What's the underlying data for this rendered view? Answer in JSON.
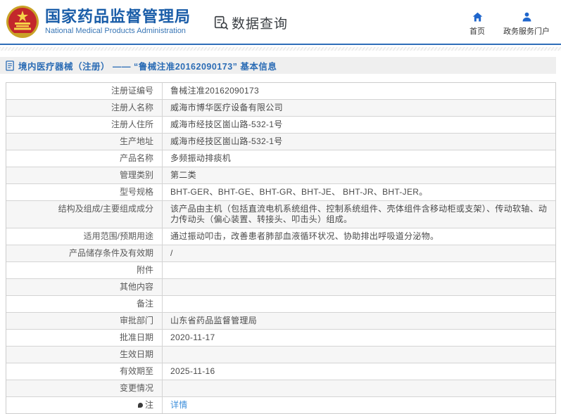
{
  "header": {
    "brand": {
      "title": "国家药品监督管理局",
      "subtitle": "National Medical Products Administration",
      "emblem_icon": "china-national-emblem",
      "title_color": "#1a5da8"
    },
    "section": {
      "icon": "data-query-icon",
      "title": "数据查询"
    },
    "nav": [
      {
        "icon": "home-icon",
        "label": "首页"
      },
      {
        "icon": "person-icon",
        "label": "政务服务门户"
      }
    ],
    "nav_icon_color": "#1f66cc"
  },
  "breadcrumb": {
    "icon": "document-icon",
    "text": "境内医疗器械（注册）  ——  “鲁械注准20162090173”  基本信息",
    "text_color": "#2b6cb5"
  },
  "table": {
    "rows": [
      {
        "label": "注册证编号",
        "value": "鲁械注准20162090173"
      },
      {
        "label": "注册人名称",
        "value": "威海市博华医疗设备有限公司"
      },
      {
        "label": "注册人住所",
        "value": "威海市经技区崮山路-532-1号"
      },
      {
        "label": "生产地址",
        "value": "威海市经技区崮山路-532-1号"
      },
      {
        "label": "产品名称",
        "value": "多频振动排痰机"
      },
      {
        "label": "管理类别",
        "value": "第二类"
      },
      {
        "label": "型号规格",
        "value": "BHT-GER、BHT-GE、BHT-GR、BHT-JE、 BHT-JR、BHT-JER。"
      },
      {
        "label": "结构及组成/主要组成成分",
        "value": "该产品由主机（包括直流电机系统组件、控制系统组件、壳体组件含移动柜或支架）、传动软轴、动力传动头（偏心装置、转接头、叩击头）组成。"
      },
      {
        "label": "适用范围/预期用途",
        "value": "通过振动叩击，改善患者肺部血液循环状况、协助排出呼吸道分泌物。"
      },
      {
        "label": "产品储存条件及有效期",
        "value": "/"
      },
      {
        "label": "附件",
        "value": ""
      },
      {
        "label": "其他内容",
        "value": ""
      },
      {
        "label": "备注",
        "value": ""
      },
      {
        "label": "审批部门",
        "value": "山东省药品监督管理局"
      },
      {
        "label": "批准日期",
        "value": "2020-11-17"
      },
      {
        "label": "生效日期",
        "value": ""
      },
      {
        "label": "有效期至",
        "value": "2025-11-16"
      },
      {
        "label": "变更情况",
        "value": ""
      },
      {
        "label": "注",
        "value": "详情",
        "value_is_link": true,
        "note_icon": true
      }
    ]
  }
}
